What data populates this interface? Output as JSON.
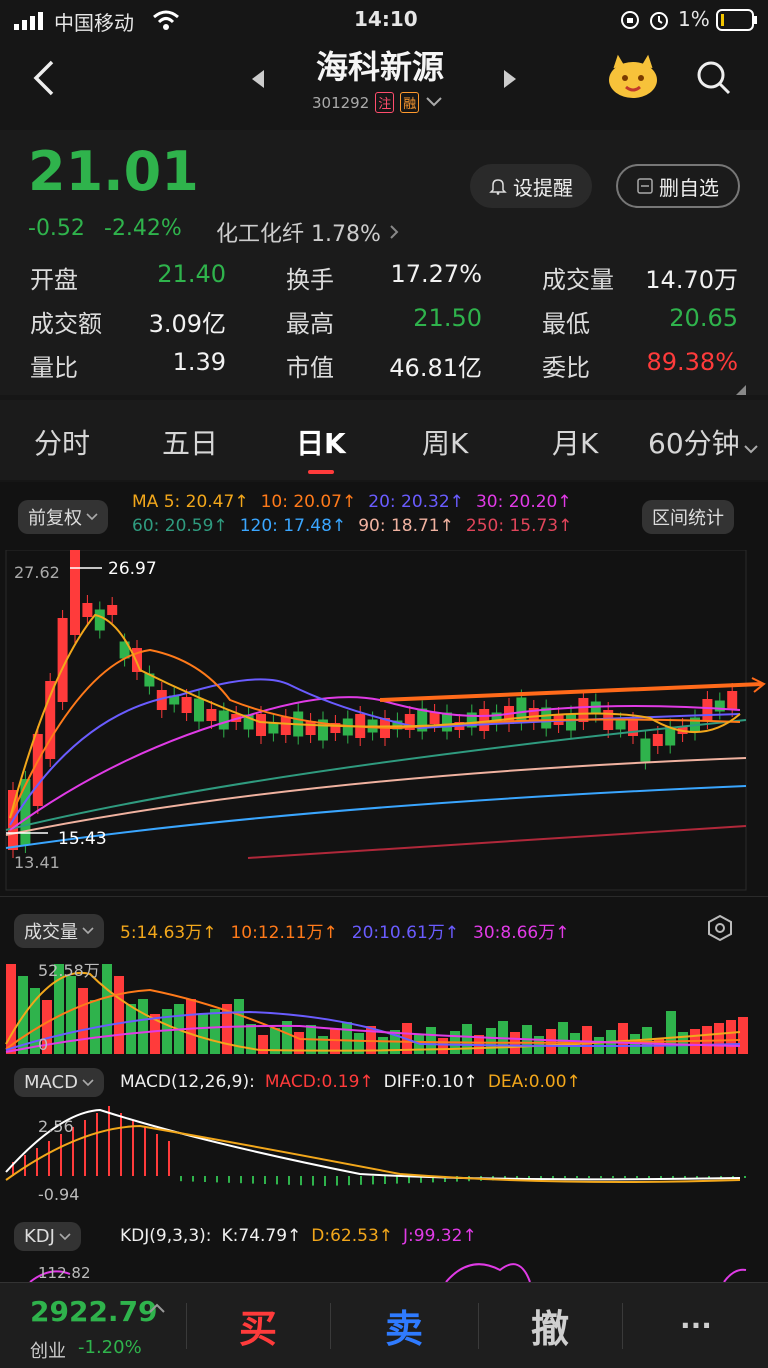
{
  "status": {
    "carrier": "中国移动",
    "time": "14:10",
    "battery": "1%"
  },
  "header": {
    "name": "海科新源",
    "code": "301292",
    "badge1": "注",
    "badge2": "融"
  },
  "quote": {
    "price": "21.01",
    "change": "-0.52",
    "change_pct": "-2.42%",
    "sector": "化工化纤 1.78%",
    "alert_btn": "设提醒",
    "remove_btn": "删自选",
    "rows": [
      [
        [
          "开盘",
          "21.40",
          "green"
        ],
        [
          "换手",
          "17.27%",
          "white"
        ],
        [
          "成交量",
          "14.70万",
          "white"
        ]
      ],
      [
        [
          "成交额",
          "3.09亿",
          "white"
        ],
        [
          "最高",
          "21.50",
          "green"
        ],
        [
          "最低",
          "20.65",
          "green"
        ]
      ],
      [
        [
          "量比",
          "1.39",
          "white"
        ],
        [
          "市值",
          "46.81亿",
          "white"
        ],
        [
          "委比",
          "89.38%",
          "red"
        ]
      ]
    ]
  },
  "tabs": [
    "分时",
    "五日",
    "日K",
    "周K",
    "月K",
    "60分钟"
  ],
  "ma": {
    "chip": "前复权",
    "line1": [
      [
        "MA 5: 20.47↑",
        "#f2a71b"
      ],
      [
        "10: 20.07↑",
        "#ff7a1a"
      ],
      [
        "20: 20.32↑",
        "#6a5cff"
      ],
      [
        "30: 20.20↑",
        "#e03be6"
      ]
    ],
    "line2": [
      [
        "60: 20.59↑",
        "#2f9b7f"
      ],
      [
        "120: 17.48↑",
        "#3aa6ff"
      ],
      [
        "90: 18.71↑",
        "#f0b2a0"
      ],
      [
        "250: 15.73↑",
        "#e0455a"
      ]
    ],
    "range_btn": "区间统计",
    "high_label": "26.97",
    "low_label": "15.43",
    "ymax": "27.62",
    "ymin": "13.41"
  },
  "volume": {
    "chip": "成交量",
    "items": [
      [
        "5:14.63万↑",
        "#f2a71b"
      ],
      [
        "10:12.11万↑",
        "#ff7a1a"
      ],
      [
        "20:10.61万↑",
        "#6a5cff"
      ],
      [
        "30:8.66万↑",
        "#e03be6"
      ]
    ],
    "ymax": "52.58万",
    "ymin": "0"
  },
  "macd": {
    "chip": "MACD",
    "label": "MACD(12,26,9):",
    "items": [
      [
        "MACD:0.19↑",
        "#ff3b3b"
      ],
      [
        "DIFF:0.10↑",
        "#f2f2f2"
      ],
      [
        "DEA:0.00↑",
        "#f2a71b"
      ]
    ],
    "ymax": "2.56",
    "ymin": "-0.94"
  },
  "kdj": {
    "chip": "KDJ",
    "label": "KDJ(9,3,3):",
    "items": [
      [
        "K:74.79↑",
        "#f2f2f2"
      ],
      [
        "D:62.53↑",
        "#f2a71b"
      ],
      [
        "J:99.32↑",
        "#e03be6"
      ]
    ],
    "ymax": "112.82"
  },
  "bottom": {
    "index": "2922.79",
    "index_name": "创业",
    "index_pct": "-1.20%",
    "buy": "买",
    "sell": "卖",
    "cancel": "撤",
    "more": "···"
  }
}
